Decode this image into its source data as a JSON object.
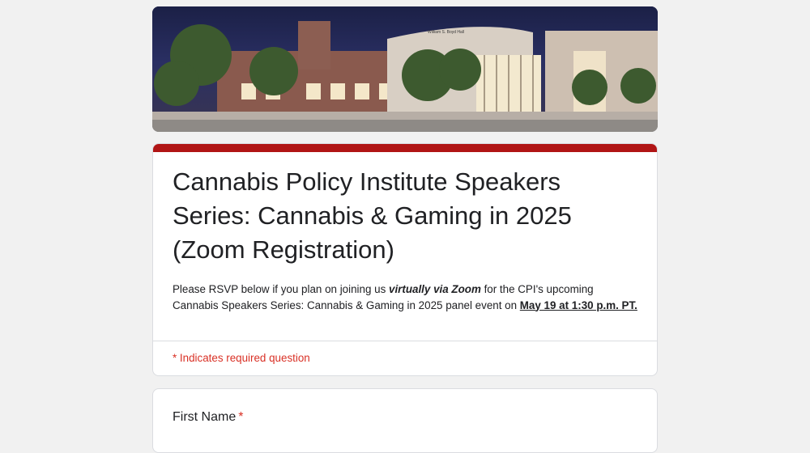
{
  "header": {
    "banner_image": "campus-building-night-photo",
    "building_sign": "William S. Boyd Hall"
  },
  "form": {
    "accent_color": "#b11515",
    "title": "Cannabis Policy Institute Speakers Series: Cannabis & Gaming in 2025 (Zoom Registration)",
    "description": {
      "part1": "Please RSVP below if you plan on joining us ",
      "emphasis": "virtually via Zoom",
      "part2": " for the CPI's upcoming Cannabis Speakers Series: Cannabis & Gaming in 2025 panel event on ",
      "date": "May 19 at 1:30 p.m. PT."
    },
    "required_note": "* Indicates required question"
  },
  "questions": [
    {
      "label": "First Name",
      "required_marker": "*"
    }
  ]
}
